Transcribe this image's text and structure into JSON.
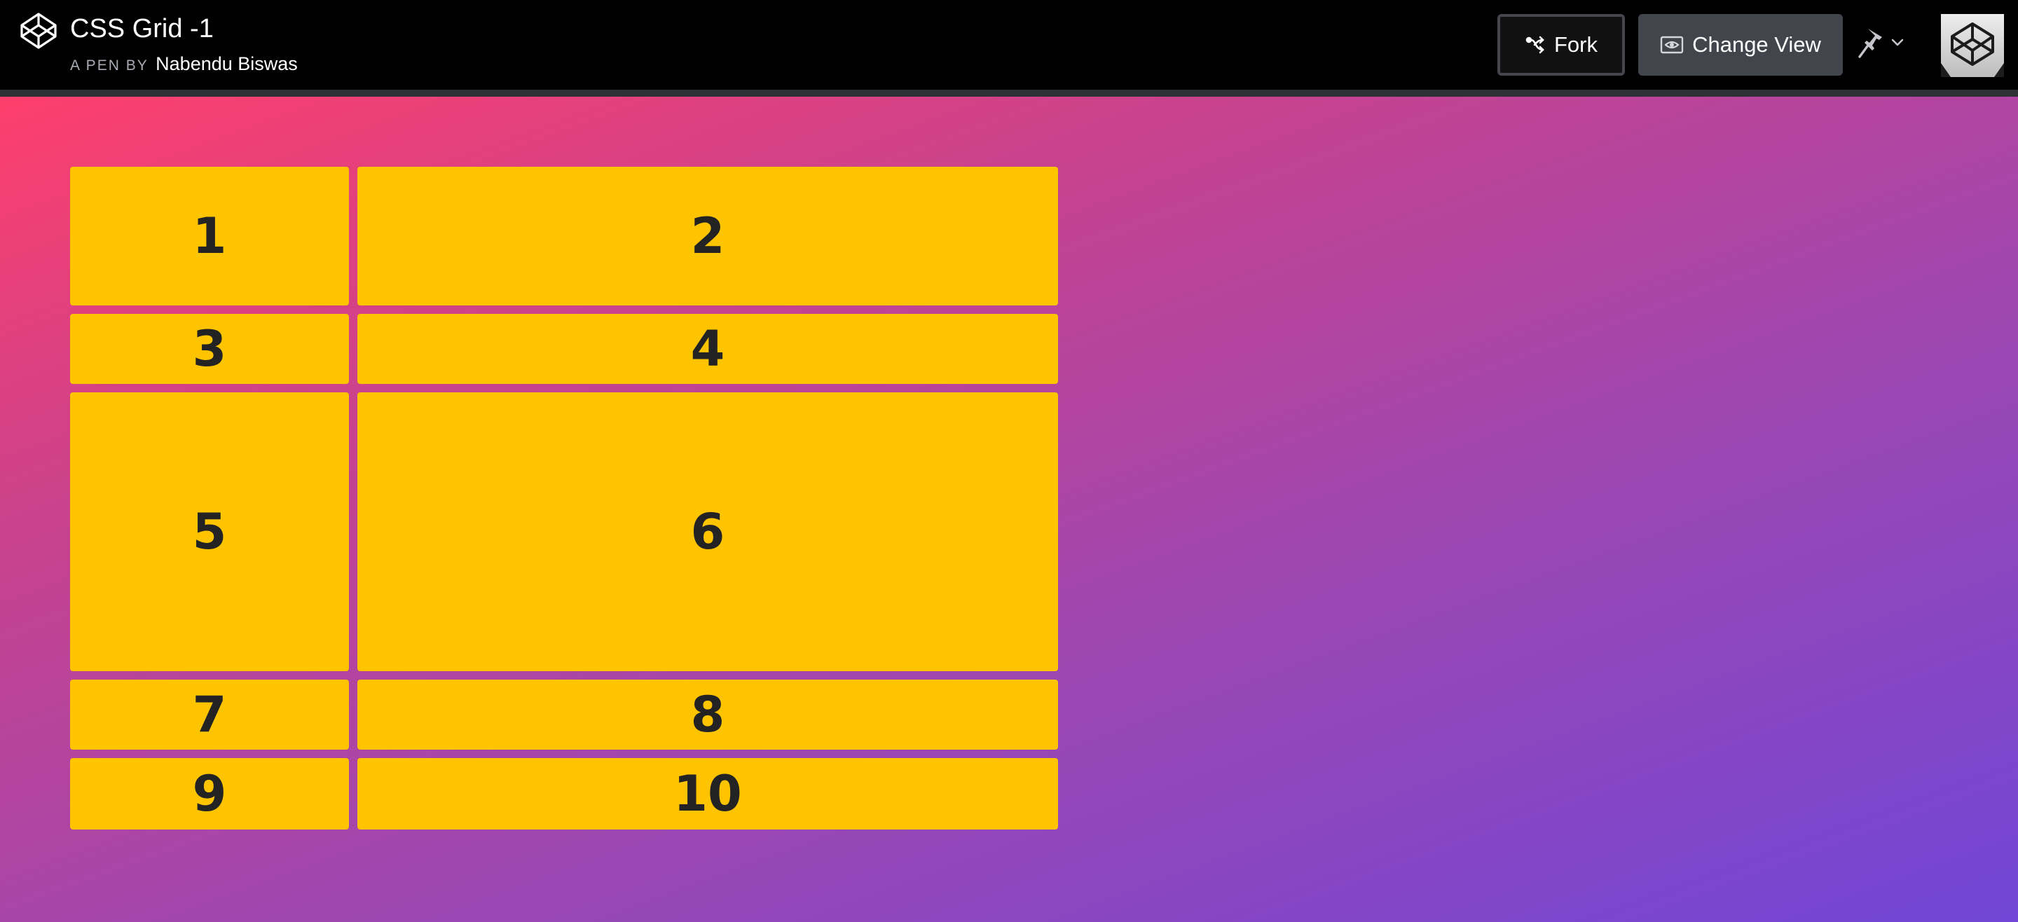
{
  "header": {
    "logo_icon": "codepen-logo-icon",
    "title": "CSS Grid -1",
    "byline_prefix": "A PEN BY",
    "author": "Nabendu Biswas",
    "fork_label": "Fork",
    "fork_icon": "fork-icon",
    "change_view_label": "Change View",
    "change_view_icon": "eye-icon",
    "pin_icon": "pin-icon",
    "dropdown_icon": "chevron-down-icon",
    "avatar_icon": "codepen-avatar"
  },
  "result": {
    "background_colors": [
      "#fe3f6c",
      "#c6428f",
      "#9c47b2",
      "#7146d6"
    ],
    "cell_color": "#ffc400",
    "cells": [
      "1",
      "2",
      "3",
      "4",
      "5",
      "6",
      "7",
      "8",
      "9",
      "10"
    ]
  }
}
